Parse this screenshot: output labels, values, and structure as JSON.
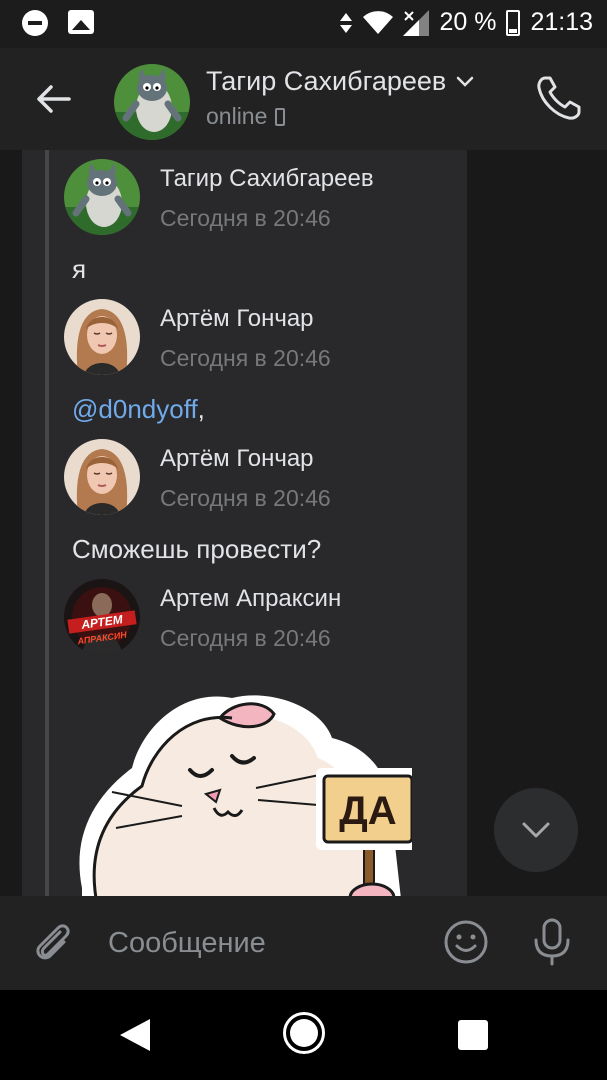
{
  "status_bar": {
    "battery": "20 %",
    "time": "21:13",
    "icons": [
      "dnd-icon",
      "image-icon",
      "data-arrows-icon",
      "wifi-icon",
      "signal-icon",
      "battery-icon"
    ]
  },
  "header": {
    "title": "Тагир Сахибгареев",
    "status": "online",
    "icons": [
      "back-arrow-icon",
      "chevron-down-icon",
      "mobile-icon",
      "phone-icon"
    ]
  },
  "forwarded_messages": [
    {
      "author": "Тагир Сахибгареев",
      "time": "Сегодня в 20:46",
      "text": "я"
    },
    {
      "author": "Артём Гончар",
      "time": "Сегодня в 20:46",
      "mention": "@d0ndyoff",
      "text_suffix": ","
    },
    {
      "author": "Артём Гончар",
      "time": "Сегодня в 20:46",
      "text": "Сможешь провести?"
    },
    {
      "author": "Артем Апраксин",
      "time": "Сегодня в 20:46",
      "avatar_text_top": "АРТЕМ",
      "avatar_text_bottom": "АПРАКСИН",
      "sticker_sign": "ДА"
    }
  ],
  "composer": {
    "placeholder": "Сообщение",
    "icons": [
      "attach-icon",
      "emoji-icon",
      "mic-icon"
    ]
  },
  "colors": {
    "background": "#19191a",
    "card": "#29292b",
    "header": "#222222",
    "link": "#71aaeb",
    "secondary_text": "#76787a"
  }
}
